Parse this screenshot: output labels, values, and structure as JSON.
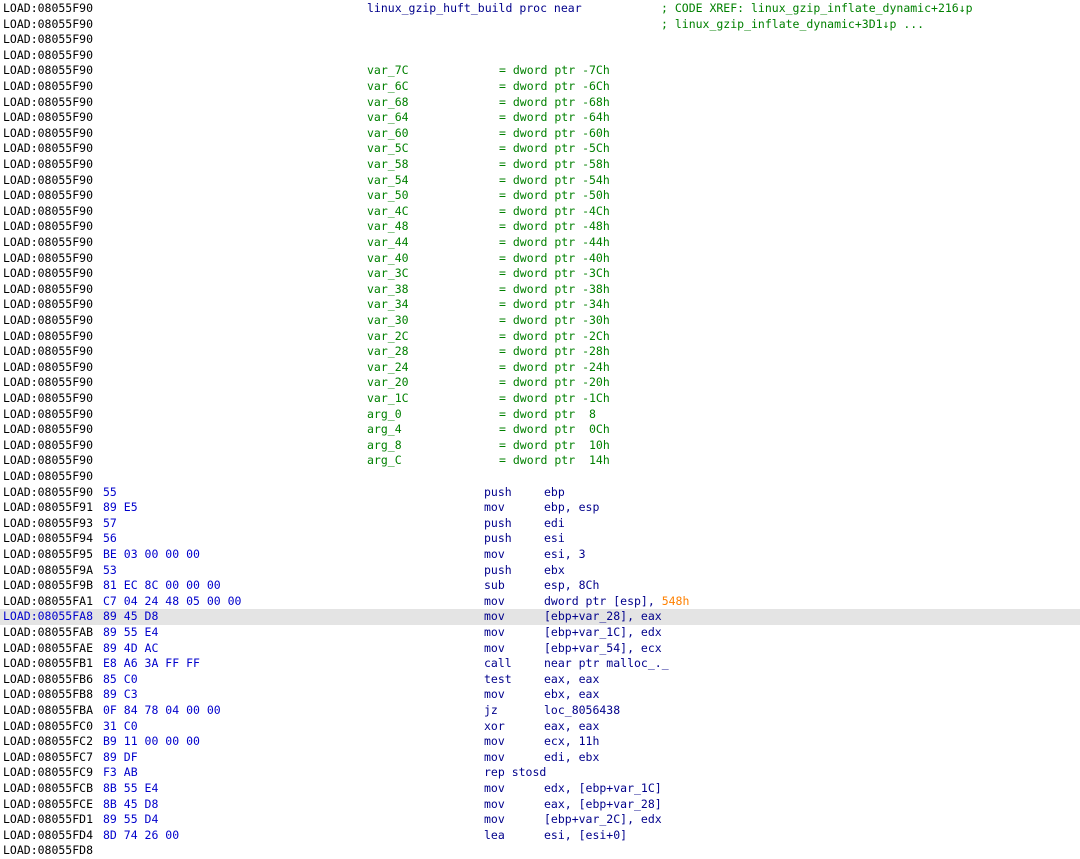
{
  "proc_header": {
    "address": "LOAD:08055F90",
    "label": "linux_gzip_huft_build proc near",
    "comment": "; CODE XREF: linux_gzip_inflate_dynamic+216↓p"
  },
  "xref_line": {
    "address": "LOAD:08055F90",
    "comment": "; linux_gzip_inflate_dynamic+3D1↓p ..."
  },
  "blank_before_vars": [
    "LOAD:08055F90",
    "LOAD:08055F90"
  ],
  "vars": [
    {
      "address": "LOAD:08055F90",
      "name": "var_7C",
      "def": "= dword ptr -7Ch"
    },
    {
      "address": "LOAD:08055F90",
      "name": "var_6C",
      "def": "= dword ptr -6Ch"
    },
    {
      "address": "LOAD:08055F90",
      "name": "var_68",
      "def": "= dword ptr -68h"
    },
    {
      "address": "LOAD:08055F90",
      "name": "var_64",
      "def": "= dword ptr -64h"
    },
    {
      "address": "LOAD:08055F90",
      "name": "var_60",
      "def": "= dword ptr -60h"
    },
    {
      "address": "LOAD:08055F90",
      "name": "var_5C",
      "def": "= dword ptr -5Ch"
    },
    {
      "address": "LOAD:08055F90",
      "name": "var_58",
      "def": "= dword ptr -58h"
    },
    {
      "address": "LOAD:08055F90",
      "name": "var_54",
      "def": "= dword ptr -54h"
    },
    {
      "address": "LOAD:08055F90",
      "name": "var_50",
      "def": "= dword ptr -50h"
    },
    {
      "address": "LOAD:08055F90",
      "name": "var_4C",
      "def": "= dword ptr -4Ch"
    },
    {
      "address": "LOAD:08055F90",
      "name": "var_48",
      "def": "= dword ptr -48h"
    },
    {
      "address": "LOAD:08055F90",
      "name": "var_44",
      "def": "= dword ptr -44h"
    },
    {
      "address": "LOAD:08055F90",
      "name": "var_40",
      "def": "= dword ptr -40h"
    },
    {
      "address": "LOAD:08055F90",
      "name": "var_3C",
      "def": "= dword ptr -3Ch"
    },
    {
      "address": "LOAD:08055F90",
      "name": "var_38",
      "def": "= dword ptr -38h"
    },
    {
      "address": "LOAD:08055F90",
      "name": "var_34",
      "def": "= dword ptr -34h"
    },
    {
      "address": "LOAD:08055F90",
      "name": "var_30",
      "def": "= dword ptr -30h"
    },
    {
      "address": "LOAD:08055F90",
      "name": "var_2C",
      "def": "= dword ptr -2Ch"
    },
    {
      "address": "LOAD:08055F90",
      "name": "var_28",
      "def": "= dword ptr -28h"
    },
    {
      "address": "LOAD:08055F90",
      "name": "var_24",
      "def": "= dword ptr -24h"
    },
    {
      "address": "LOAD:08055F90",
      "name": "var_20",
      "def": "= dword ptr -20h"
    },
    {
      "address": "LOAD:08055F90",
      "name": "var_1C",
      "def": "= dword ptr -1Ch"
    },
    {
      "address": "LOAD:08055F90",
      "name": "arg_0",
      "def": "= dword ptr  8"
    },
    {
      "address": "LOAD:08055F90",
      "name": "arg_4",
      "def": "= dword ptr  0Ch"
    },
    {
      "address": "LOAD:08055F90",
      "name": "arg_8",
      "def": "= dword ptr  10h"
    },
    {
      "address": "LOAD:08055F90",
      "name": "arg_C",
      "def": "= dword ptr  14h"
    }
  ],
  "blank_after_vars": "LOAD:08055F90",
  "instructions": [
    {
      "address": "LOAD:08055F90",
      "bytes": "55",
      "mnemonic": "push",
      "operands": "ebp"
    },
    {
      "address": "LOAD:08055F91",
      "bytes": "89 E5",
      "mnemonic": "mov",
      "operands": "ebp, esp"
    },
    {
      "address": "LOAD:08055F93",
      "bytes": "57",
      "mnemonic": "push",
      "operands": "edi"
    },
    {
      "address": "LOAD:08055F94",
      "bytes": "56",
      "mnemonic": "push",
      "operands": "esi"
    },
    {
      "address": "LOAD:08055F95",
      "bytes": "BE 03 00 00 00",
      "mnemonic": "mov",
      "operands": "esi, 3"
    },
    {
      "address": "LOAD:08055F9A",
      "bytes": "53",
      "mnemonic": "push",
      "operands": "ebx"
    },
    {
      "address": "LOAD:08055F9B",
      "bytes": "81 EC 8C 00 00 00",
      "mnemonic": "sub",
      "operands": "esp, 8Ch"
    },
    {
      "address": "LOAD:08055FA1",
      "bytes": "C7 04 24 48 05 00 00",
      "mnemonic": "mov",
      "operands": "dword ptr [esp], ",
      "operand_num": "548h"
    },
    {
      "address": "LOAD:08055FA8",
      "bytes": "89 45 D8",
      "mnemonic": "mov",
      "operands": "[ebp+var_28], eax",
      "highlight": true
    },
    {
      "address": "LOAD:08055FAB",
      "bytes": "89 55 E4",
      "mnemonic": "mov",
      "operands": "[ebp+var_1C], edx"
    },
    {
      "address": "LOAD:08055FAE",
      "bytes": "89 4D AC",
      "mnemonic": "mov",
      "operands": "[ebp+var_54], ecx"
    },
    {
      "address": "LOAD:08055FB1",
      "bytes": "E8 A6 3A FF FF",
      "mnemonic": "call",
      "operands": "near ptr malloc_._"
    },
    {
      "address": "LOAD:08055FB6",
      "bytes": "85 C0",
      "mnemonic": "test",
      "operands": "eax, eax"
    },
    {
      "address": "LOAD:08055FB8",
      "bytes": "89 C3",
      "mnemonic": "mov",
      "operands": "ebx, eax"
    },
    {
      "address": "LOAD:08055FBA",
      "bytes": "0F 84 78 04 00 00",
      "mnemonic": "jz",
      "operands": "loc_8056438"
    },
    {
      "address": "LOAD:08055FC0",
      "bytes": "31 C0",
      "mnemonic": "xor",
      "operands": "eax, eax"
    },
    {
      "address": "LOAD:08055FC2",
      "bytes": "B9 11 00 00 00",
      "mnemonic": "mov",
      "operands": "ecx, 11h"
    },
    {
      "address": "LOAD:08055FC7",
      "bytes": "89 DF",
      "mnemonic": "mov",
      "operands": "edi, ebx"
    },
    {
      "address": "LOAD:08055FC9",
      "bytes": "F3 AB",
      "mnemonic": "rep stosd",
      "operands": ""
    },
    {
      "address": "LOAD:08055FCB",
      "bytes": "8B 55 E4",
      "mnemonic": "mov",
      "operands": "edx, [ebp+var_1C]"
    },
    {
      "address": "LOAD:08055FCE",
      "bytes": "8B 45 D8",
      "mnemonic": "mov",
      "operands": "eax, [ebp+var_28]"
    },
    {
      "address": "LOAD:08055FD1",
      "bytes": "89 55 D4",
      "mnemonic": "mov",
      "operands": "[ebp+var_2C], edx"
    },
    {
      "address": "LOAD:08055FD4",
      "bytes": "8D 74 26 00",
      "mnemonic": "lea",
      "operands": "esi, [esi+0]"
    }
  ],
  "trailing_address": "LOAD:08055FD8"
}
